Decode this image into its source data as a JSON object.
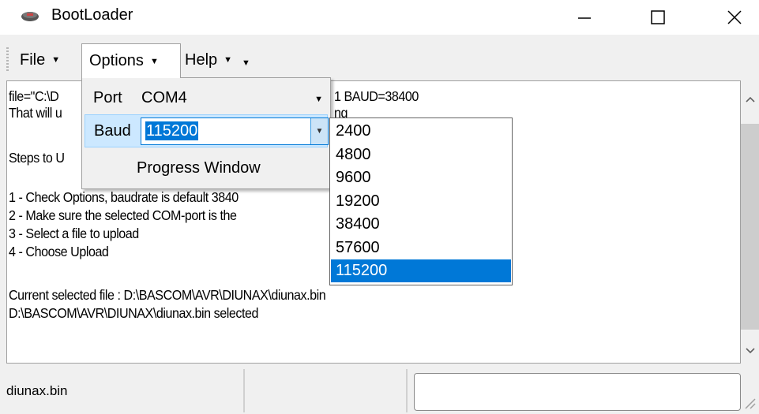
{
  "window": {
    "title": "BootLoader",
    "icon": "chip-icon",
    "controls": [
      "minimize-icon",
      "maximize-icon",
      "close-icon"
    ]
  },
  "menubar": {
    "file": "File",
    "options": "Options",
    "help": "Help"
  },
  "options_menu": {
    "port_label": "Port",
    "port_value": "COM4",
    "baud_label": "Baud",
    "baud_value": "115200",
    "progress_window": "Progress Window"
  },
  "baud_options": [
    "2400",
    "4800",
    "9600",
    "19200",
    "38400",
    "57600",
    "115200"
  ],
  "baud_selected": "115200",
  "log": {
    "line1a": "file=\"C:\\D",
    "line1b": "1 BAUD=38400",
    "line2a": "That will u",
    "line2b": "ng",
    "line3": "Steps to U",
    "line4": "1 - Check Options, baudrate is default 3840",
    "line5": "2 - Make sure the selected COM-port is the",
    "line6": "3 - Select a file to upload",
    "line7": "4 - Choose Upload",
    "line8": "Current selected file : D:\\BASCOM\\AVR\\DIUNAX\\diunax.bin",
    "line9": "D:\\BASCOM\\AVR\\DIUNAX\\diunax.bin selected"
  },
  "statusbar": {
    "file": "diunax.bin"
  },
  "colors": {
    "accent": "#0078d7",
    "highlight": "#cce8ff"
  }
}
